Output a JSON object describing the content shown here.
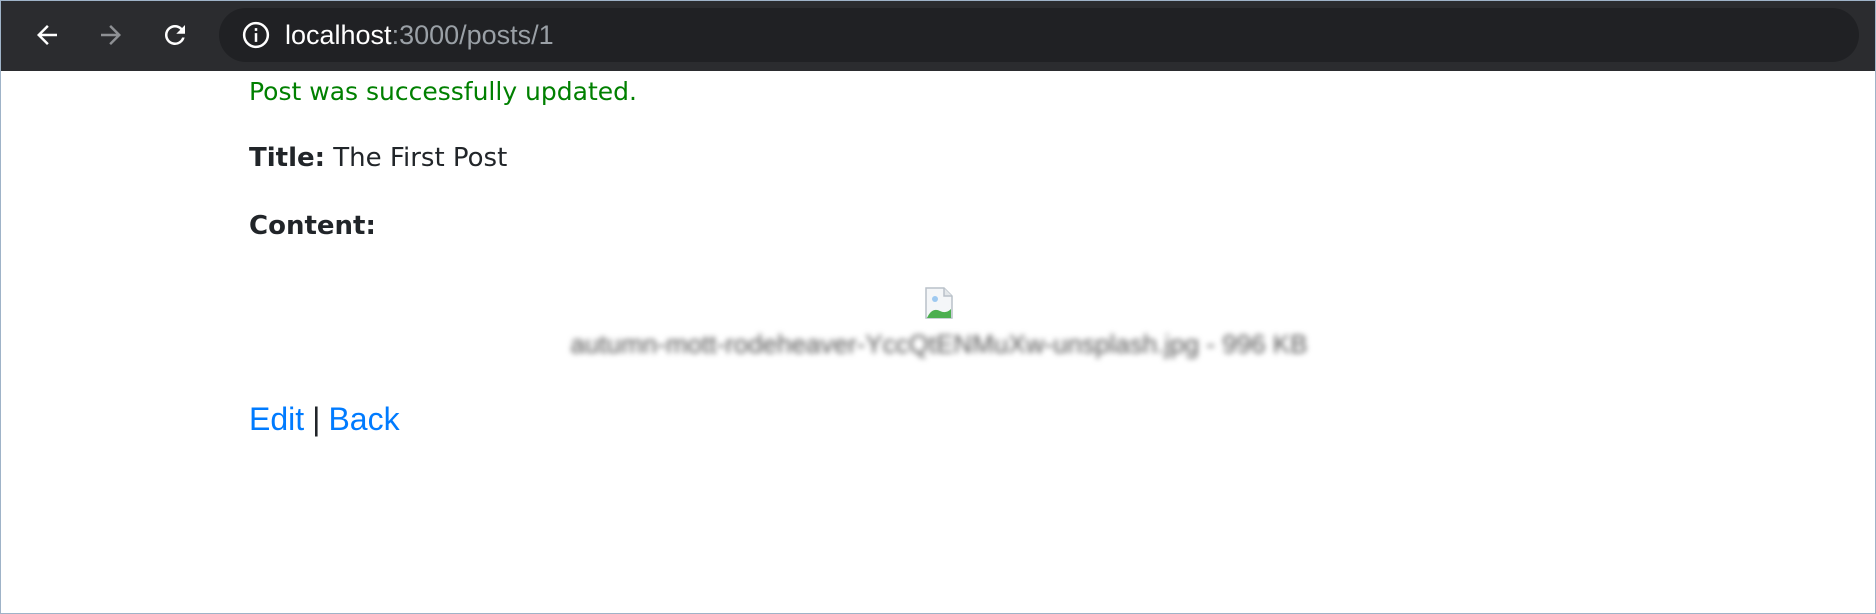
{
  "browser": {
    "url_host": "localhost",
    "url_path": ":3000/posts/1",
    "icons": {
      "back": "arrow-left-icon",
      "forward": "arrow-right-icon",
      "reload": "reload-icon",
      "info": "info-icon"
    }
  },
  "page": {
    "notice": "Post was successfully updated.",
    "title_label": "Title:",
    "title_value": "The First Post",
    "content_label": "Content:",
    "attachment": {
      "caption": "autumn-mott-rodeheaver-YccQtENMuXw-unsplash.jpg - 996 KB",
      "icon": "broken-image-icon"
    },
    "links": {
      "edit": "Edit",
      "separator": "|",
      "back": "Back"
    }
  },
  "colors": {
    "notice": "#008000",
    "link": "#007bff",
    "toolbar": "#2b2c2f",
    "omnibox": "#202124"
  }
}
